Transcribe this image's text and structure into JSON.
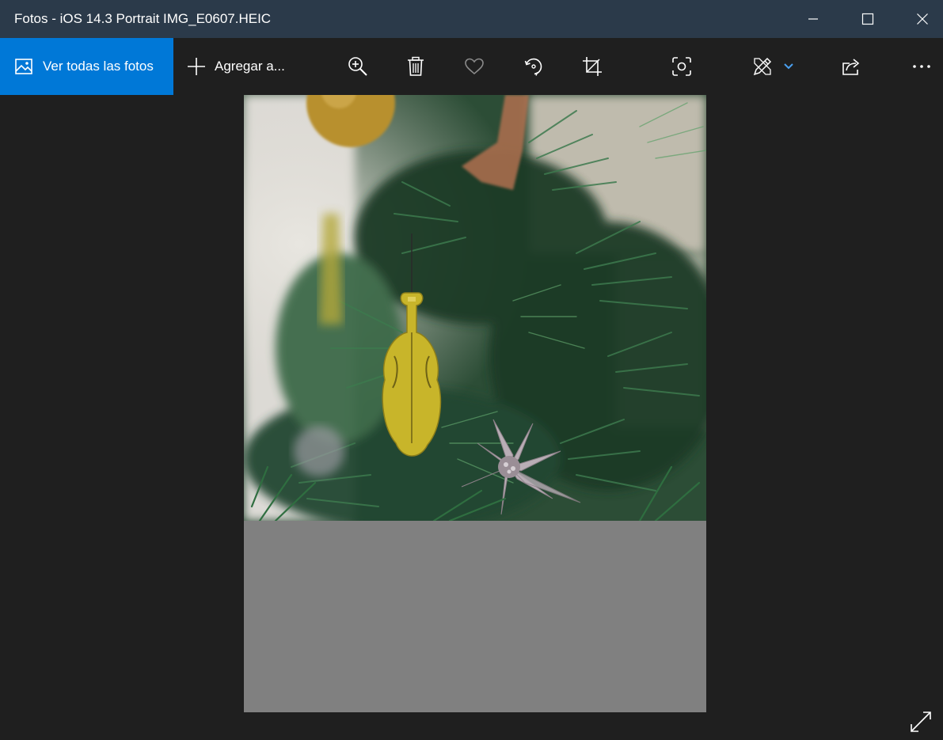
{
  "window": {
    "title": "Fotos - iOS 14.3 Portrait IMG_E0607.HEIC",
    "minimize_icon": "minimize-icon",
    "maximize_icon": "maximize-icon",
    "close_icon": "close-icon"
  },
  "toolbar": {
    "view_all_label": "Ver todas las fotos",
    "view_all_icon": "photos-icon",
    "add_label": "Agregar a...",
    "add_icon": "plus-icon",
    "buttons": [
      {
        "name": "zoom-in",
        "icon": "zoom-in-icon"
      },
      {
        "name": "delete",
        "icon": "trash-icon"
      },
      {
        "name": "favorite",
        "icon": "heart-icon"
      },
      {
        "name": "rotate",
        "icon": "rotate-icon"
      },
      {
        "name": "crop",
        "icon": "crop-icon"
      },
      {
        "name": "visual-search",
        "icon": "scan-icon"
      },
      {
        "name": "edit-create",
        "icon": "edit-create-icon"
      },
      {
        "name": "share",
        "icon": "share-icon"
      },
      {
        "name": "more",
        "icon": "more-icon"
      }
    ]
  },
  "colors": {
    "titlebar": "#2b3a4a",
    "toolbar": "#1f1f1f",
    "accent": "#0078d7",
    "canvas_gray": "#808080",
    "dropdown_accent": "#4aa0f0"
  },
  "photo": {
    "subject": "christmas-tree-with-violin-ornament-and-poinsettia"
  },
  "expand_icon": "expand-icon"
}
